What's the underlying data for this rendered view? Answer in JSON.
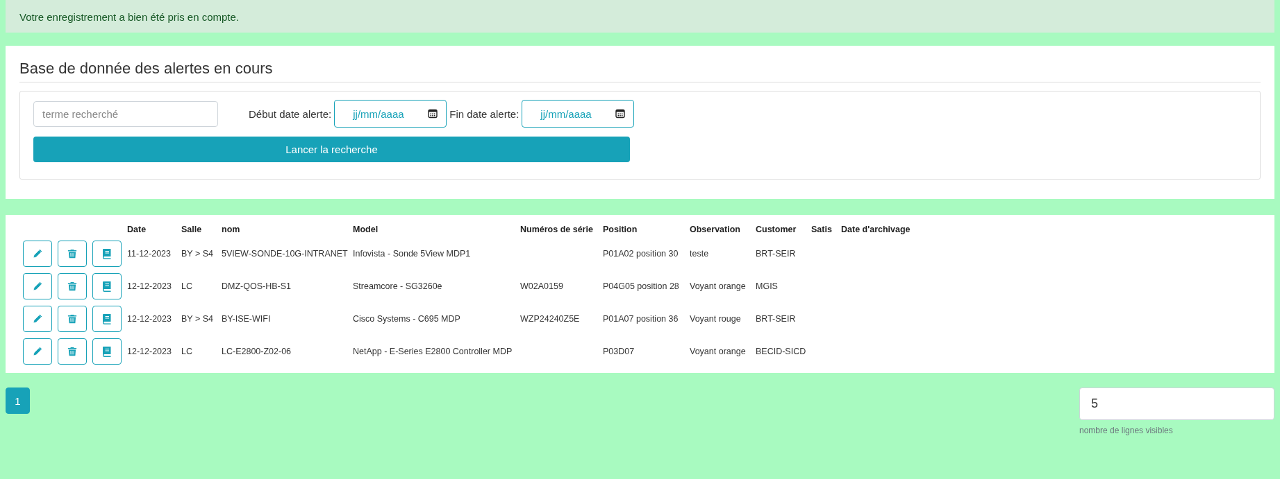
{
  "alert": {
    "message": "Votre enregistrement a bien été pris en compte."
  },
  "search_panel": {
    "title": "Base de donnée des alertes en cours",
    "search_field": {
      "placeholder": "terme recherché"
    },
    "start_date": {
      "label": "Début date alerte:",
      "placeholder": "jj/mm/aaaa"
    },
    "end_date": {
      "label": "Fin date alerte:",
      "placeholder": "jj/mm/aaaa"
    },
    "submit_button": "Lancer la recherche"
  },
  "table": {
    "columns": [
      "Date",
      "Salle",
      "nom",
      "Model",
      "Numéros de série",
      "Position",
      "Observation",
      "Customer",
      "Satis",
      "Date d'archivage"
    ],
    "rows": [
      [
        "11-12-2023",
        "BY > S4",
        "5VIEW-SONDE-10G-INTRANET",
        "Infovista - Sonde 5View MDP1",
        null,
        "P01A02 position 30",
        "teste",
        "BRT-SEIR",
        null,
        null
      ],
      [
        "12-12-2023",
        "LC",
        "DMZ-QOS-HB-S1",
        "Streamcore - SG3260e",
        "W02A0159",
        "P04G05 position 28",
        "Voyant orange",
        "MGIS",
        null,
        null
      ],
      [
        "12-12-2023",
        "BY > S4",
        "BY-ISE-WIFI",
        "Cisco Systems - C695 MDP",
        "WZP24240Z5E",
        "P01A07 position 36",
        "Voyant rouge",
        "BRT-SEIR",
        null,
        null
      ],
      [
        "12-12-2023",
        "LC",
        "LC-E2800-Z02-06",
        "NetApp - E-Series E2800 Controller MDP",
        null,
        "P03D07",
        "Voyant orange",
        "BECID-SICD",
        null,
        null
      ]
    ]
  },
  "pagination": [
    {
      "label": "1",
      "selected": true
    }
  ],
  "rows_visible": {
    "value": "5",
    "help": "nombre de lignes visibles"
  }
}
